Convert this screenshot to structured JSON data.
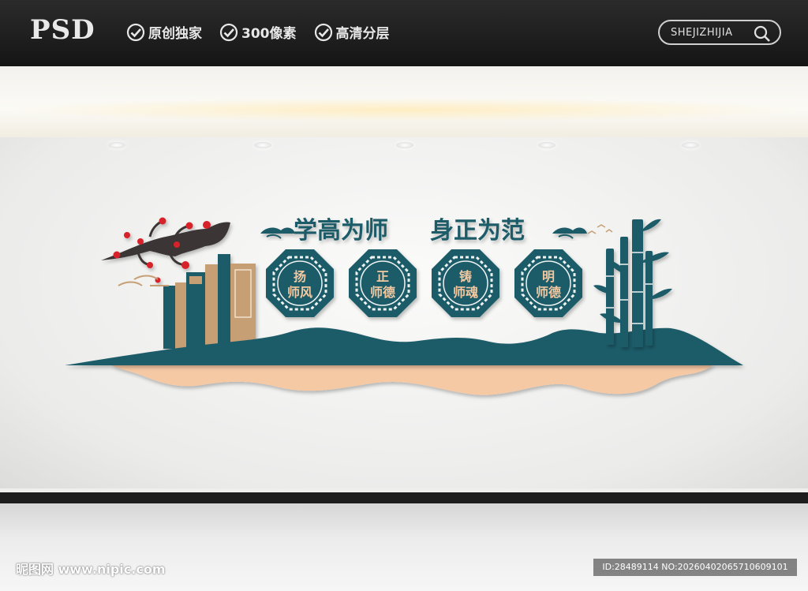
{
  "header": {
    "logo": "PSD",
    "badges": [
      {
        "label": "原创独家"
      },
      {
        "label": "300像素"
      },
      {
        "label": "高清分层"
      }
    ],
    "search_label": "SHEJIZHIJIA"
  },
  "mural": {
    "title_left": "学高为师",
    "title_right": "身正为范",
    "octagons": [
      {
        "line1": "扬",
        "line2": "师风"
      },
      {
        "line1": "正",
        "line2": "师德"
      },
      {
        "line1": "铸",
        "line2": "师魂"
      },
      {
        "line1": "明",
        "line2": "师德"
      }
    ],
    "colors": {
      "teal": "#1f5c69",
      "tan": "#c79f75",
      "peach": "#f6c9a5",
      "blossom": "#d8202a",
      "branch": "#3a3536"
    }
  },
  "footer": {
    "watermark": "昵图网 www.nipic.com",
    "image_id": "ID:28489114 NO:20260402065710609101"
  }
}
